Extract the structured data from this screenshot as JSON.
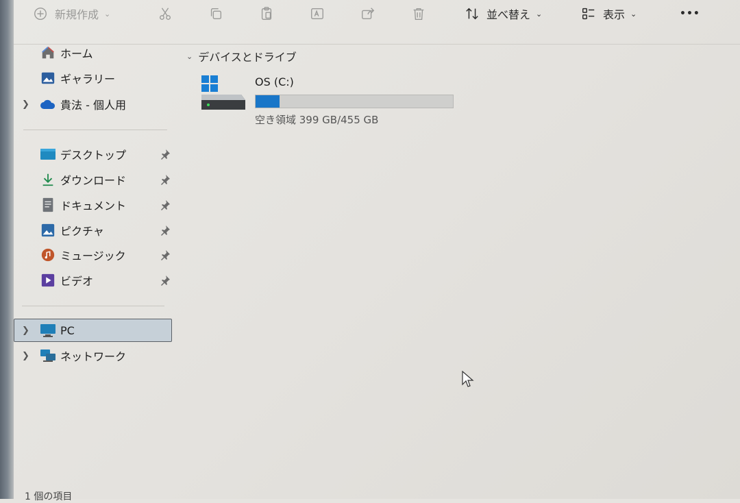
{
  "toolbar": {
    "new_label": "新規作成",
    "sort_label": "並べ替え",
    "view_label": "表示",
    "more_label": "•••"
  },
  "sidebar": {
    "quick": [
      {
        "label": "ホーム",
        "icon": "home-icon"
      },
      {
        "label": "ギャラリー",
        "icon": "gallery-icon"
      },
      {
        "label": "貴法 - 個人用",
        "icon": "onedrive-cloud-icon"
      }
    ],
    "pinned": [
      {
        "label": "デスクトップ",
        "icon": "desktop-folder-icon"
      },
      {
        "label": "ダウンロード",
        "icon": "download-icon"
      },
      {
        "label": "ドキュメント",
        "icon": "document-icon"
      },
      {
        "label": "ピクチャ",
        "icon": "pictures-icon"
      },
      {
        "label": "ミュージック",
        "icon": "music-icon"
      },
      {
        "label": "ビデオ",
        "icon": "video-icon"
      }
    ],
    "locations": [
      {
        "label": "PC",
        "icon": "pc-icon"
      },
      {
        "label": "ネットワーク",
        "icon": "network-icon"
      }
    ]
  },
  "content": {
    "section_title": "デバイスとドライブ",
    "drive": {
      "name": "OS (C:)",
      "free_text": "空き領域 399 GB/455 GB",
      "used_fraction": 0.123,
      "bar_color": "#1976c8"
    }
  },
  "status": {
    "text": "1 個の項目"
  }
}
